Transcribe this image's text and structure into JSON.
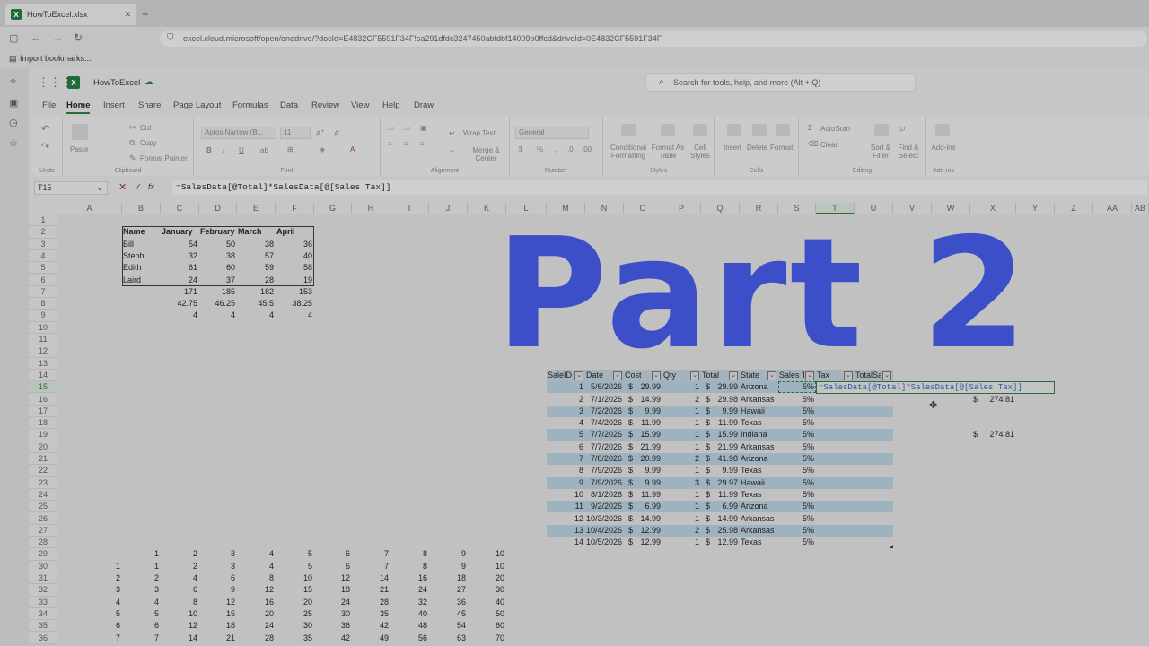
{
  "browser": {
    "tab_title": "HowToExcel.xlsx",
    "url": "excel.cloud.microsoft/open/onedrive/?docId=E4832CF5591F34F!sa291dfdc3247450abfdbf14009b0ffcd&driveId=0E4832CF5591F34F",
    "bookmark": "Import bookmarks..."
  },
  "app": {
    "file_name": "HowToExcel",
    "search_placeholder": "Search for tools, help, and more (Alt + Q)"
  },
  "menu_tabs": [
    "File",
    "Home",
    "Insert",
    "Share",
    "Page Layout",
    "Formulas",
    "Data",
    "Review",
    "View",
    "Help",
    "Draw"
  ],
  "ribbon": {
    "undo_label": "Undo",
    "clipboard": {
      "paste": "Paste",
      "cut": "Cut",
      "copy": "Copy",
      "format_painter": "Format Painter",
      "label": "Clipboard"
    },
    "font": {
      "name": "Aptos Narrow (B...",
      "size": "11",
      "label": "Font"
    },
    "alignment": {
      "wrap": "Wrap Text",
      "merge": "Merge & Center",
      "label": "Alignment"
    },
    "number": {
      "format": "General",
      "label": "Number"
    },
    "styles": {
      "conditional": "Conditional Formatting",
      "format_as_table": "Format As Table",
      "cell_styles": "Cell Styles",
      "label": "Styles"
    },
    "cells": {
      "insert": "Insert",
      "delete": "Delete",
      "format": "Format",
      "label": "Cells"
    },
    "editing": {
      "autosum": "AutoSum",
      "clear": "Clear",
      "sort": "Sort & Filter",
      "find": "Find & Select",
      "label": "Editing"
    },
    "addins": {
      "label": "Add-ins",
      "btn": "Add-ins"
    }
  },
  "formula_bar": {
    "name_box": "T15",
    "formula": "=SalesData[@Total]*SalesData[@[Sales Tax]]"
  },
  "columns": [
    "A",
    "B",
    "C",
    "D",
    "E",
    "F",
    "G",
    "H",
    "I",
    "J",
    "K",
    "L",
    "M",
    "N",
    "O",
    "P",
    "Q",
    "R",
    "S",
    "T",
    "U",
    "V",
    "W",
    "X",
    "Y",
    "Z",
    "AA",
    "AB"
  ],
  "rows": [
    "1",
    "2",
    "3",
    "4",
    "5",
    "6",
    "7",
    "8",
    "9",
    "10",
    "11",
    "12",
    "13",
    "14",
    "15",
    "16",
    "17",
    "18",
    "19",
    "20",
    "21",
    "22",
    "23",
    "24",
    "25",
    "26",
    "27",
    "28",
    "29",
    "30",
    "31",
    "32",
    "33",
    "34",
    "35",
    "36"
  ],
  "overlay_text": "Part 2",
  "small_table": {
    "headers": [
      "Name",
      "January",
      "February",
      "March",
      "April"
    ],
    "rows": [
      [
        "Bill",
        "54",
        "50",
        "38",
        "36"
      ],
      [
        "Steph",
        "32",
        "38",
        "57",
        "40"
      ],
      [
        "Edith",
        "61",
        "60",
        "59",
        "58"
      ],
      [
        "Laird",
        "24",
        "37",
        "28",
        "19"
      ]
    ],
    "sum_row": [
      "171",
      "185",
      "182",
      "153"
    ],
    "avg_row": [
      "42.75",
      "46.25",
      "45.5",
      "38.25"
    ],
    "count_row": [
      "4",
      "4",
      "4",
      "4"
    ]
  },
  "sales_table": {
    "headers": [
      "SaleID",
      "Date",
      "Cost",
      "Qty",
      "Total",
      "State",
      "Sales T",
      "Tax",
      "TotalSa"
    ],
    "rows": [
      [
        "1",
        "5/6/2026",
        "29.99",
        "1",
        "29.99",
        "Arizona",
        "5%"
      ],
      [
        "2",
        "7/1/2026",
        "14.99",
        "2",
        "29.98",
        "Arkansas",
        "5%"
      ],
      [
        "3",
        "7/2/2026",
        "9.99",
        "1",
        "9.99",
        "Hawaii",
        "5%"
      ],
      [
        "4",
        "7/4/2026",
        "11.99",
        "1",
        "11.99",
        "Texas",
        "5%"
      ],
      [
        "5",
        "7/7/2026",
        "15.99",
        "1",
        "15.99",
        "Indiana",
        "5%"
      ],
      [
        "6",
        "7/7/2026",
        "21.99",
        "1",
        "21.99",
        "Arkansas",
        "5%"
      ],
      [
        "7",
        "7/8/2026",
        "20.99",
        "2",
        "41.98",
        "Arizona",
        "5%"
      ],
      [
        "8",
        "7/9/2026",
        "9.99",
        "1",
        "9.99",
        "Texas",
        "5%"
      ],
      [
        "9",
        "7/9/2026",
        "9.99",
        "3",
        "29.97",
        "Hawaii",
        "5%"
      ],
      [
        "10",
        "8/1/2026",
        "11.99",
        "1",
        "11.99",
        "Texas",
        "5%"
      ],
      [
        "11",
        "9/2/2026",
        "6.99",
        "1",
        "6.99",
        "Arizona",
        "5%"
      ],
      [
        "12",
        "10/3/2026",
        "14.99",
        "1",
        "14.99",
        "Arkansas",
        "5%"
      ],
      [
        "13",
        "10/4/2026",
        "12.99",
        "2",
        "25.98",
        "Arkansas",
        "5%"
      ],
      [
        "14",
        "10/5/2026",
        "12.99",
        "1",
        "12.99",
        "Texas",
        "5%"
      ]
    ],
    "currency": "$",
    "x16": "274.81",
    "x19": "274.81"
  },
  "mult_table": {
    "header": [
      "1",
      "2",
      "3",
      "4",
      "5",
      "6",
      "7",
      "8",
      "9",
      "10"
    ],
    "rows": [
      [
        "1",
        "1",
        "2",
        "3",
        "4",
        "5",
        "6",
        "7",
        "8",
        "9",
        "10"
      ],
      [
        "2",
        "2",
        "4",
        "6",
        "8",
        "10",
        "12",
        "14",
        "16",
        "18",
        "20"
      ],
      [
        "3",
        "3",
        "6",
        "9",
        "12",
        "15",
        "18",
        "21",
        "24",
        "27",
        "30"
      ],
      [
        "4",
        "4",
        "8",
        "12",
        "16",
        "20",
        "24",
        "28",
        "32",
        "36",
        "40"
      ],
      [
        "5",
        "5",
        "10",
        "15",
        "20",
        "25",
        "30",
        "35",
        "40",
        "45",
        "50"
      ],
      [
        "6",
        "6",
        "12",
        "18",
        "24",
        "30",
        "36",
        "42",
        "48",
        "54",
        "60"
      ],
      [
        "7",
        "7",
        "14",
        "21",
        "28",
        "35",
        "42",
        "49",
        "56",
        "63",
        "70"
      ]
    ]
  },
  "colors": {
    "overlay": "#3c4fc9",
    "excel_green": "#1f6b3a",
    "band": "#9fb2c0"
  }
}
